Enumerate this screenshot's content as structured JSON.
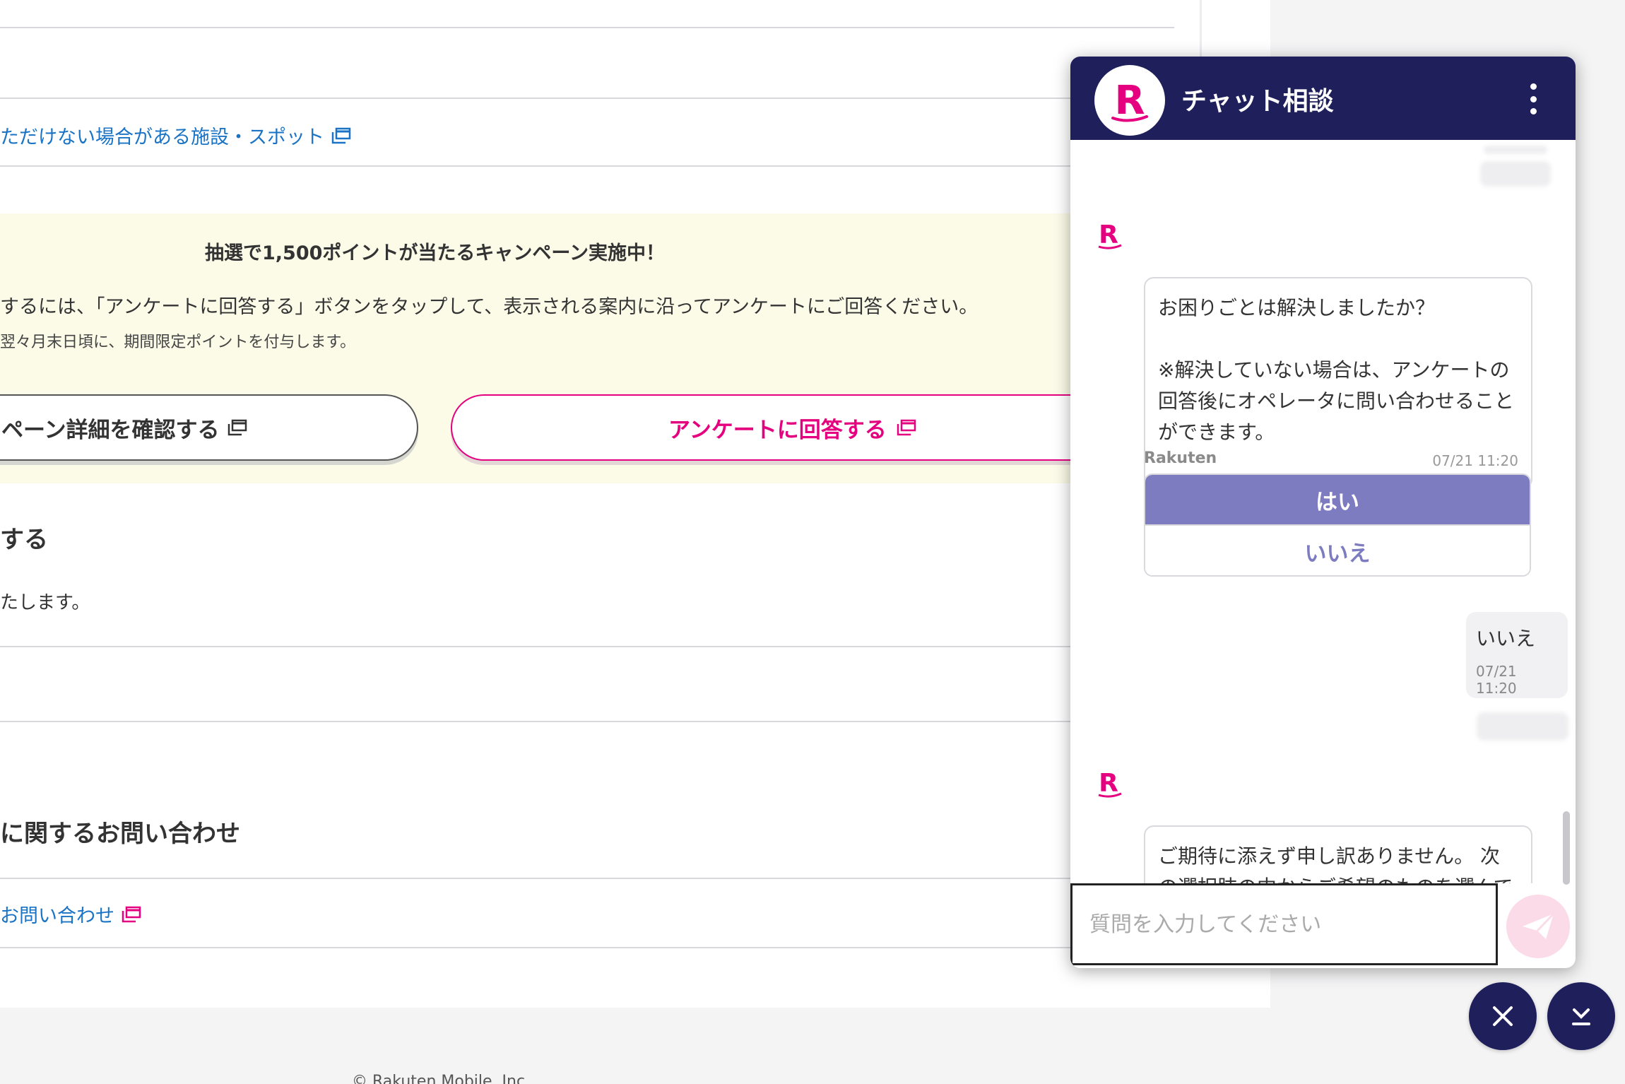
{
  "page": {
    "facilities_link": "ただけない場合がある施設・スポット",
    "campaign": {
      "title": "抽選で1,500ポイントが当たるキャンペーン実施中！",
      "text": "するには、「アンケートに回答する」ボタンをタップして、表示される案内に沿ってアンケートにご回答ください。",
      "note": "翌々月末日頃に、期間限定ポイントを付与します。",
      "detail_button": "ペーン詳細を確認する",
      "survey_button": "アンケートに回答する"
    },
    "section1_heading": "する",
    "section1_text": "たします。",
    "section2_heading": "に関するお問い合わせ",
    "contact_link": "お問い合わせ",
    "footer": "© Rakuten Mobile, Inc."
  },
  "chat": {
    "title": "チャット相談",
    "messages": [
      {
        "text": "お困りごとは解決しましたか？\n\n※解決していない場合は、アンケートの回答後にオペレータに問い合わせることができます。",
        "time": "07/21 11:20"
      },
      {
        "text": "ご期待に添えず申し訳ありません。 次の選択肢の中からご希望のものを選んでください。",
        "time": ""
      }
    ],
    "sender_name": "Rakuten",
    "choices": {
      "yes": "はい",
      "no": "いいえ"
    },
    "user_message": {
      "text": "いいえ",
      "time": "07/21 11:20"
    },
    "input_placeholder": "質問を入力してください"
  },
  "colors": {
    "brand_pink": "#e5007f",
    "header_navy": "#1f1f5c",
    "choice_purple": "#7d7cc0",
    "link_blue": "#1a73c5"
  },
  "icons": [
    "external-link-icon",
    "rakuten-logo-icon",
    "kebab-menu-icon",
    "send-icon",
    "close-icon",
    "minimize-icon"
  ]
}
